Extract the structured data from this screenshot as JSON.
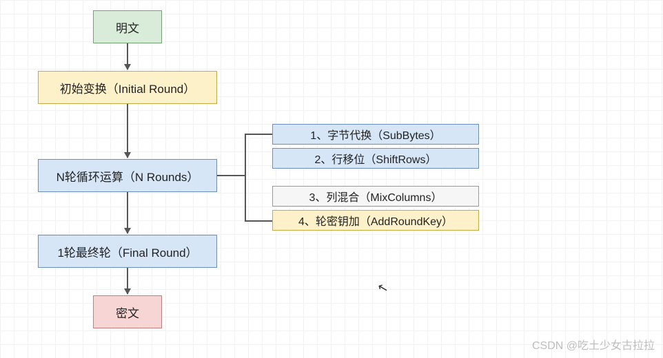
{
  "nodes": {
    "plaintext": "明文",
    "initial_round": "初始变换（Initial Round）",
    "n_rounds": "N轮循环运算（N Rounds）",
    "final_round": "1轮最终轮（Final Round）",
    "ciphertext": "密文"
  },
  "round_steps": {
    "step1": "1、字节代换（SubBytes）",
    "step2": "2、行移位（ShiftRows）",
    "step3": "3、列混合（MixColumns）",
    "step4": "4、轮密钥加（AddRoundKey）"
  },
  "colors": {
    "green_bg": "#d9ebd9",
    "yellow_bg": "#fdf1c9",
    "blue_bg": "#d7e6f7",
    "white_bg": "#f6f6f6",
    "red_bg": "#f7d5d5",
    "grid": "#f2f2f2",
    "arrow": "#555555"
  },
  "watermark": "CSDN @吃土少女古拉拉",
  "chart_data": {
    "type": "flowchart",
    "direction": "top-to-bottom",
    "nodes": [
      {
        "id": "plaintext",
        "label": "明文",
        "color": "green"
      },
      {
        "id": "initial",
        "label": "初始变换（Initial Round）",
        "color": "yellow"
      },
      {
        "id": "rounds",
        "label": "N轮循环运算（N Rounds）",
        "color": "blue",
        "details": [
          {
            "label": "1、字节代换（SubBytes）",
            "color": "blue"
          },
          {
            "label": "2、行移位（ShiftRows）",
            "color": "blue"
          },
          {
            "label": "3、列混合（MixColumns）",
            "color": "white"
          },
          {
            "label": "4、轮密钥加（AddRoundKey）",
            "color": "yellow"
          }
        ]
      },
      {
        "id": "final",
        "label": "1轮最终轮（Final Round）",
        "color": "blue"
      },
      {
        "id": "ciphertext",
        "label": "密文",
        "color": "red"
      }
    ],
    "edges": [
      [
        "plaintext",
        "initial"
      ],
      [
        "initial",
        "rounds"
      ],
      [
        "rounds",
        "final"
      ],
      [
        "final",
        "ciphertext"
      ]
    ]
  }
}
